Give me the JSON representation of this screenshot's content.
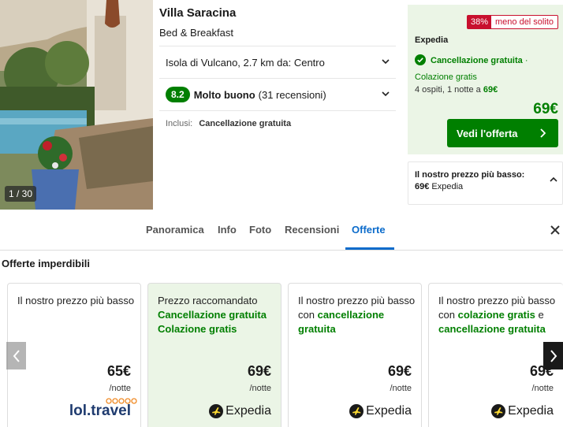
{
  "hotel": {
    "name": "Villa Saracina",
    "type": "Bed & Breakfast",
    "photo_counter": "1 / 30",
    "location": "Isola di Vulcano, 2.7 km da: Centro",
    "rating_score": "8.2",
    "rating_label": "Molto buono",
    "rating_reviews": "(31 recensioni)",
    "included_label": "Inclusi:",
    "included_value": "Cancellazione gratuita"
  },
  "deal": {
    "discount_pct": "38%",
    "discount_text": "meno del solito",
    "provider": "Expedia",
    "cancellation": "Cancellazione gratuita",
    "separator": "·",
    "breakfast": "Colazione gratis",
    "guests_prefix": "4 ospiti, 1 notte a",
    "guests_price": "69€",
    "price": "69€",
    "button_label": "Vedi l'offerta"
  },
  "lowest": {
    "title": "Il nostro prezzo più basso:",
    "price": "69€",
    "provider": "Expedia"
  },
  "tabs": [
    {
      "label": "Panoramica",
      "active": false
    },
    {
      "label": "Info",
      "active": false
    },
    {
      "label": "Foto",
      "active": false
    },
    {
      "label": "Recensioni",
      "active": false
    },
    {
      "label": "Offerte",
      "active": true
    }
  ],
  "section_title": "Offerte imperdibili",
  "offers": [
    {
      "desc_plain": "Il nostro prezzo più basso",
      "price": "65€",
      "unit": "/notte",
      "provider": "lol.travel"
    },
    {
      "desc_plain": "Prezzo raccomandato",
      "desc_green1": "Cancellazione gratuita",
      "desc_green2": "Colazione gratis",
      "price": "69€",
      "unit": "/notte",
      "provider": "Expedia"
    },
    {
      "desc_plain": "Il nostro prezzo più basso con",
      "desc_green1": "cancellazione gratuita",
      "price": "69€",
      "unit": "/notte",
      "provider": "Expedia"
    },
    {
      "desc_plain": "Il nostro prezzo più basso con",
      "desc_green1": "colazione gratis",
      "desc_conj": "e",
      "desc_green2": "cancellazione gratuita",
      "price": "69€",
      "unit": "/notte",
      "provider": "Expedia"
    }
  ],
  "colors": {
    "accent_green": "#007f00",
    "tab_blue": "#0b6bcb",
    "discount_red": "#c8102e"
  }
}
